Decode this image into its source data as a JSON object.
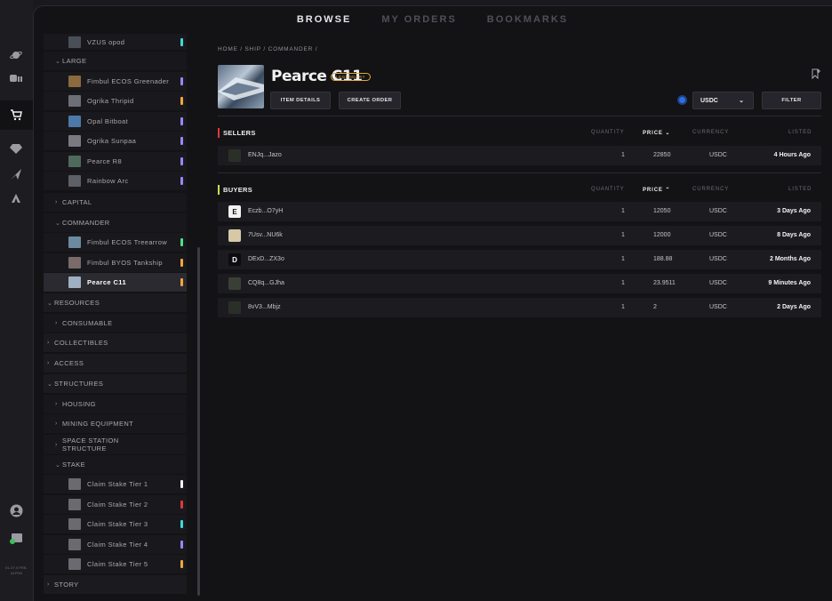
{
  "nav": {
    "tabs": [
      {
        "label": "BROWSE",
        "active": true
      },
      {
        "label": "MY ORDERS"
      },
      {
        "label": "BOOKMARKS"
      }
    ]
  },
  "rail": {
    "icons": [
      "planet-icon",
      "robot-icon",
      "cart-icon",
      "gem-icon",
      "ship-icon",
      "atlas-icon",
      "account-icon",
      "wallet-icon"
    ],
    "version": "EL.07.0 PRE-ALPHA"
  },
  "sidebar": {
    "top_item": {
      "label": "VZUS opod",
      "rarity_color": "#3fd9d4"
    },
    "large": {
      "label": "LARGE",
      "items": [
        {
          "label": "Fimbul ECOS Greenader",
          "rarity_color": "#9b86ff"
        },
        {
          "label": "Ogrika Thripid",
          "rarity_color": "#f2a53c"
        },
        {
          "label": "Opal Bitboat",
          "rarity_color": "#9b86ff"
        },
        {
          "label": "Ogrika Sunpaa",
          "rarity_color": "#9b86ff"
        },
        {
          "label": "Pearce R8",
          "rarity_color": "#9b86ff"
        },
        {
          "label": "Rainbow Arc",
          "rarity_color": "#9b86ff"
        }
      ]
    },
    "capital": {
      "label": "CAPITAL"
    },
    "commander": {
      "label": "COMMANDER",
      "items": [
        {
          "label": "Fimbul ECOS Treearrow",
          "rarity_color": "#4fe08a"
        },
        {
          "label": "Fimbul BYOS Tankship",
          "rarity_color": "#f2a53c"
        },
        {
          "label": "Pearce C11",
          "rarity_color": "#f2a53c",
          "selected": true
        }
      ]
    },
    "resources": {
      "label": "RESOURCES"
    },
    "consumable": {
      "label": "CONSUMABLE"
    },
    "collectibles": {
      "label": "COLLECTIBLES"
    },
    "access": {
      "label": "ACCESS"
    },
    "structures": {
      "label": "STRUCTURES"
    },
    "housing": {
      "label": "HOUSING"
    },
    "mining": {
      "label": "MINING EQUIPMENT"
    },
    "space_station": {
      "label": "SPACE STATION STRUCTURE"
    },
    "stake": {
      "label": "STAKE",
      "items": [
        {
          "label": "Claim Stake Tier 1",
          "rarity_color": "#f4f4f4"
        },
        {
          "label": "Claim Stake Tier 2",
          "rarity_color": "#e0383a"
        },
        {
          "label": "Claim Stake Tier 3",
          "rarity_color": "#3fd9d4"
        },
        {
          "label": "Claim Stake Tier 4",
          "rarity_color": "#9b86ff"
        },
        {
          "label": "Claim Stake Tier 5",
          "rarity_color": "#f2a53c"
        }
      ]
    },
    "story": {
      "label": "STORY"
    }
  },
  "breadcrumb": "HOME / SHIP / COMMANDER /",
  "item": {
    "title": "Pearce C11",
    "rarity": "LEGENDARY",
    "rarity_color": "#e0a83c"
  },
  "actions": {
    "details": "ITEM DETAILS",
    "create": "CREATE ORDER",
    "currency": "USDC",
    "filter": "FILTER"
  },
  "columns": {
    "quantity": "QUANTITY",
    "price": "PRICE",
    "currency": "CURRENCY",
    "listed": "LISTED"
  },
  "sellers": {
    "label": "SELLERS",
    "accent": "#e0383a",
    "rows": [
      {
        "user": "ENJq...Jazo",
        "qty": "1",
        "price": "22850",
        "currency": "USDC",
        "listed": "4 Hours Ago"
      }
    ]
  },
  "buyers": {
    "label": "BUYERS",
    "accent": "#c9e04a",
    "rows": [
      {
        "user": "Eczb...O7yH",
        "avatar": "E",
        "qty": "1",
        "price": "12050",
        "currency": "USDC",
        "listed": "3 Days Ago"
      },
      {
        "user": "7Usv...NU6k",
        "avatar": "",
        "qty": "1",
        "price": "12000",
        "currency": "USDC",
        "listed": "8 Days Ago"
      },
      {
        "user": "DExD...ZX3o",
        "avatar": "D",
        "qty": "1",
        "price": "188.88",
        "currency": "USDC",
        "listed": "2 Months Ago"
      },
      {
        "user": "CQ8q...GJha",
        "avatar": "",
        "qty": "1",
        "price": "23.9511",
        "currency": "USDC",
        "listed": "9 Minutes Ago"
      },
      {
        "user": "8vV3...Mbjz",
        "avatar": "",
        "qty": "1",
        "price": "2",
        "currency": "USDC",
        "listed": "2 Days Ago"
      }
    ]
  }
}
